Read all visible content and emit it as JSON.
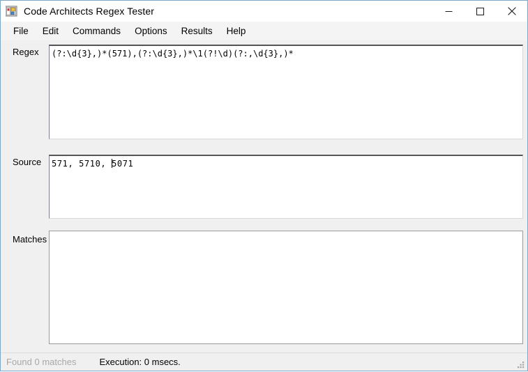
{
  "window": {
    "title": "Code Architects Regex Tester",
    "icon": "application-form-icon",
    "controls": {
      "minimize": "minimize-button",
      "maximize": "maximize-button",
      "close": "close-button"
    }
  },
  "menu": {
    "items": [
      {
        "label": "File"
      },
      {
        "label": "Edit"
      },
      {
        "label": "Commands"
      },
      {
        "label": "Options"
      },
      {
        "label": "Results"
      },
      {
        "label": "Help"
      }
    ]
  },
  "fields": {
    "regex": {
      "label": "Regex",
      "value": "(?:\\d{3},)*(571),(?:\\d{3},)*\\1(?!\\d)(?:,\\d{3},)*",
      "placeholder": ""
    },
    "source": {
      "label": "Source",
      "value_before_caret": "571, 5710, ",
      "value_after_caret": "5071",
      "value": "571, 5710, 5071",
      "placeholder": ""
    },
    "matches": {
      "label": "Matches",
      "value": "",
      "placeholder": ""
    }
  },
  "status": {
    "matches_text": "Found 0 matches",
    "execution_text": "Execution: 0 msecs.",
    "grip": "resize-grip"
  },
  "colors": {
    "window_border": "#7da7c4",
    "client_background": "#f0f0f0",
    "menu_background": "#f4f4f4",
    "textbox_background": "#ffffff",
    "status_disabled_text": "#a8a8a8",
    "status_text": "#000000"
  }
}
